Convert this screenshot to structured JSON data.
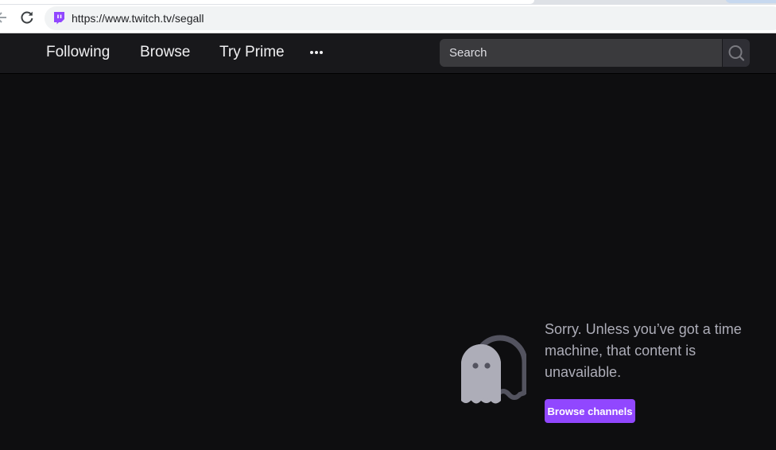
{
  "browser": {
    "url": "https://www.twitch.tv/segall",
    "icons": {
      "back": "back-arrow-icon",
      "reload": "reload-icon",
      "favicon": "twitch-favicon-icon"
    }
  },
  "nav": {
    "links": [
      {
        "label": "Following"
      },
      {
        "label": "Browse"
      },
      {
        "label": "Try Prime"
      }
    ],
    "more_icon": "more-dots-icon",
    "search": {
      "placeholder": "Search",
      "icon": "search-icon"
    }
  },
  "main": {
    "illustration": "ghost-icon",
    "message": "Sorry. Unless you’ve got a time machine, that content is unavailable.",
    "button_label": "Browse channels"
  },
  "colors": {
    "accent": "#9147ff",
    "nav_bg": "#18181b",
    "page_bg": "#0e0e10",
    "search_bg": "#3a3a3d",
    "message_text": "#adadb8"
  }
}
